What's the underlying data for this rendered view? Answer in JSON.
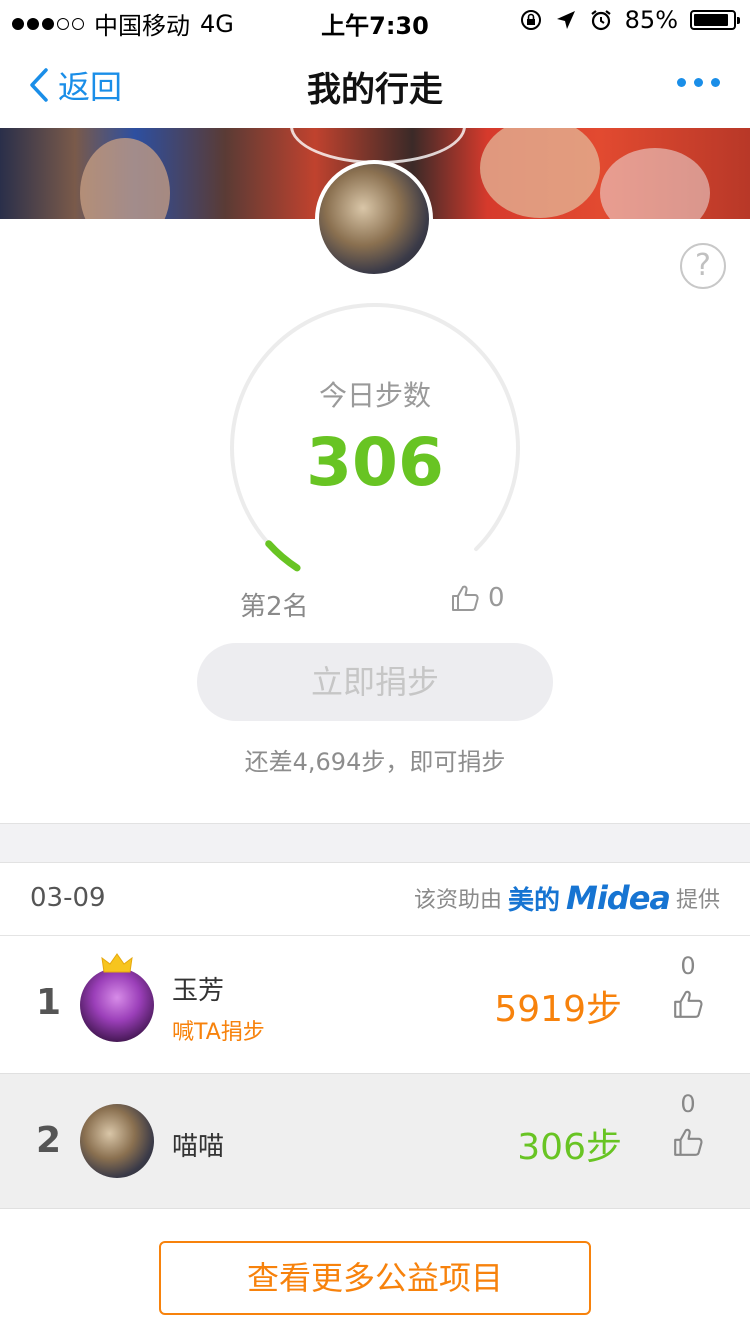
{
  "status_bar": {
    "carrier": "中国移动",
    "network": "4G",
    "time": "上午7:30",
    "battery": "85%",
    "battery_level": 0.85
  },
  "nav": {
    "back_label": "返回",
    "title": "我的行走"
  },
  "gauge": {
    "label": "今日步数",
    "value": "306"
  },
  "stats": {
    "rank": "第2名",
    "likes": "0"
  },
  "donate": {
    "button_label": "立即捐步",
    "remaining": "还差4,694步，即可捐步"
  },
  "leaderboard": {
    "date": "03-09",
    "sponsor_prefix": "该资助由",
    "brand_cn": "美的",
    "brand_en": "Midea",
    "sponsor_suffix": "提供",
    "rows": [
      {
        "rank": "1",
        "name": "玉芳",
        "cheer": "喊TA捐步",
        "steps": "5919步",
        "likes": "0"
      },
      {
        "rank": "2",
        "name": "喵喵",
        "steps": "306步",
        "likes": "0"
      }
    ]
  },
  "footer": {
    "more_button": "查看更多公益项目"
  },
  "colors": {
    "accent_blue": "#1a8ee8",
    "step_green": "#68c423",
    "orange": "#f7820c"
  }
}
